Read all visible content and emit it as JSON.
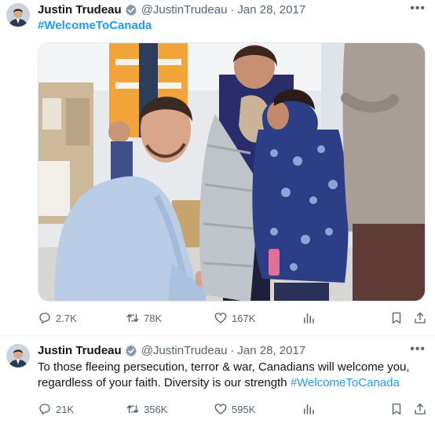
{
  "tweets": [
    {
      "author": {
        "name": "Justin Trudeau",
        "handle": "@JustinTrudeau",
        "verified": true,
        "avatar_icon": "profile-photo"
      },
      "separator": "·",
      "date": "Jan 28, 2017",
      "hashtag": "#WelcomeToCanada",
      "media": {
        "type": "photo",
        "icon": "photo-prime-minister-greeting-refugee-child"
      },
      "stats": {
        "replies": "2.7K",
        "reposts": "78K",
        "likes": "167K"
      }
    },
    {
      "author": {
        "name": "Justin Trudeau",
        "handle": "@JustinTrudeau",
        "verified": true,
        "avatar_icon": "profile-photo"
      },
      "separator": "·",
      "date": "Jan 28, 2017",
      "text": "To those fleeing persecution, terror & war, Canadians will welcome you, regardless of your faith. Diversity is our strength",
      "hashtag": "#WelcomeToCanada",
      "stats": {
        "replies": "21K",
        "reposts": "356K",
        "likes": "595K"
      }
    }
  ],
  "more_icon": "more-dots",
  "colors": {
    "link": "#1d9bf0",
    "secondary_text": "#536471",
    "verified": "#829aab",
    "divider": "#eff3f4"
  }
}
